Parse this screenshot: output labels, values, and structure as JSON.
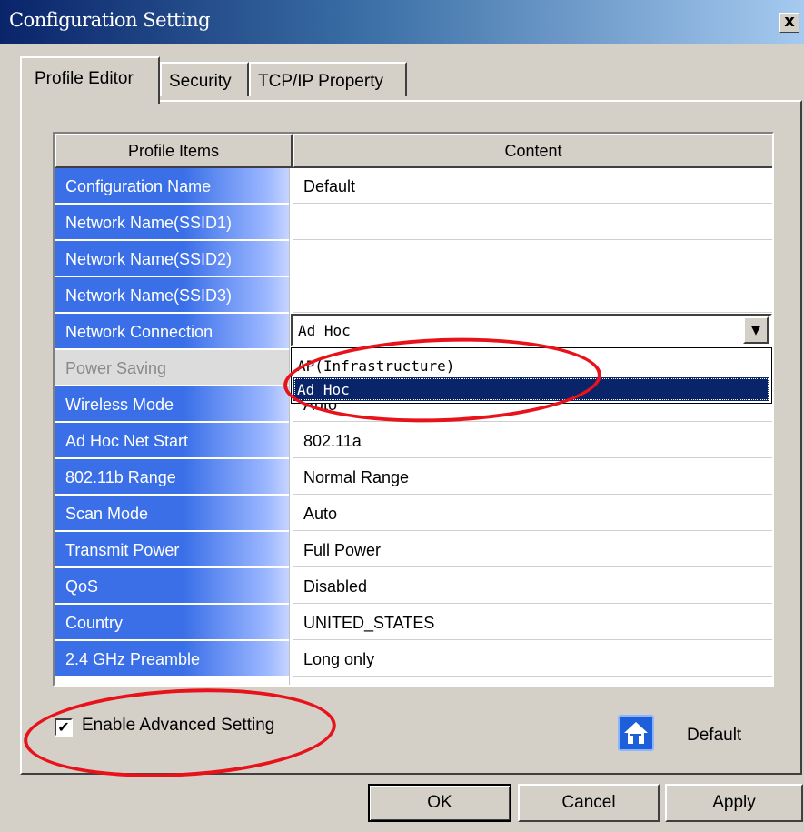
{
  "window": {
    "title": "Configuration Setting",
    "close_symbol": "x"
  },
  "tabs": [
    "Profile Editor",
    "Security",
    "TCP/IP Property"
  ],
  "table": {
    "headers": {
      "items": "Profile Items",
      "content": "Content"
    },
    "rows": [
      {
        "label": "Configuration Name",
        "value": "Default"
      },
      {
        "label": "Network Name(SSID1)",
        "value": ""
      },
      {
        "label": "Network Name(SSID2)",
        "value": ""
      },
      {
        "label": "Network Name(SSID3)",
        "value": ""
      },
      {
        "label": "Network Connection",
        "value": ""
      },
      {
        "label": "Power Saving",
        "value": ""
      },
      {
        "label": "Wireless Mode",
        "value": "Auto"
      },
      {
        "label": "Ad Hoc Net Start",
        "value": "802.11a"
      },
      {
        "label": "802.11b Range",
        "value": "Normal Range"
      },
      {
        "label": "Scan Mode",
        "value": "Auto"
      },
      {
        "label": "Transmit Power",
        "value": "Full Power"
      },
      {
        "label": "QoS",
        "value": "Disabled"
      },
      {
        "label": "Country",
        "value": "UNITED_STATES"
      },
      {
        "label": "2.4 GHz Preamble",
        "value": "Long only"
      }
    ]
  },
  "network_connection": {
    "selected": "Ad Hoc",
    "options": [
      "AP(Infrastructure)",
      "Ad Hoc"
    ]
  },
  "advanced": {
    "label": "Enable Advanced Setting",
    "checked": true,
    "check_mark": "✔"
  },
  "default_label": "Default",
  "buttons": {
    "ok": "OK",
    "cancel": "Cancel",
    "apply": "Apply"
  },
  "colors": {
    "title_bar": "#0a246a",
    "row_label_bg": "#3a6fe8",
    "highlight_ellipse": "#e8121b",
    "selection": "#0a246a"
  }
}
